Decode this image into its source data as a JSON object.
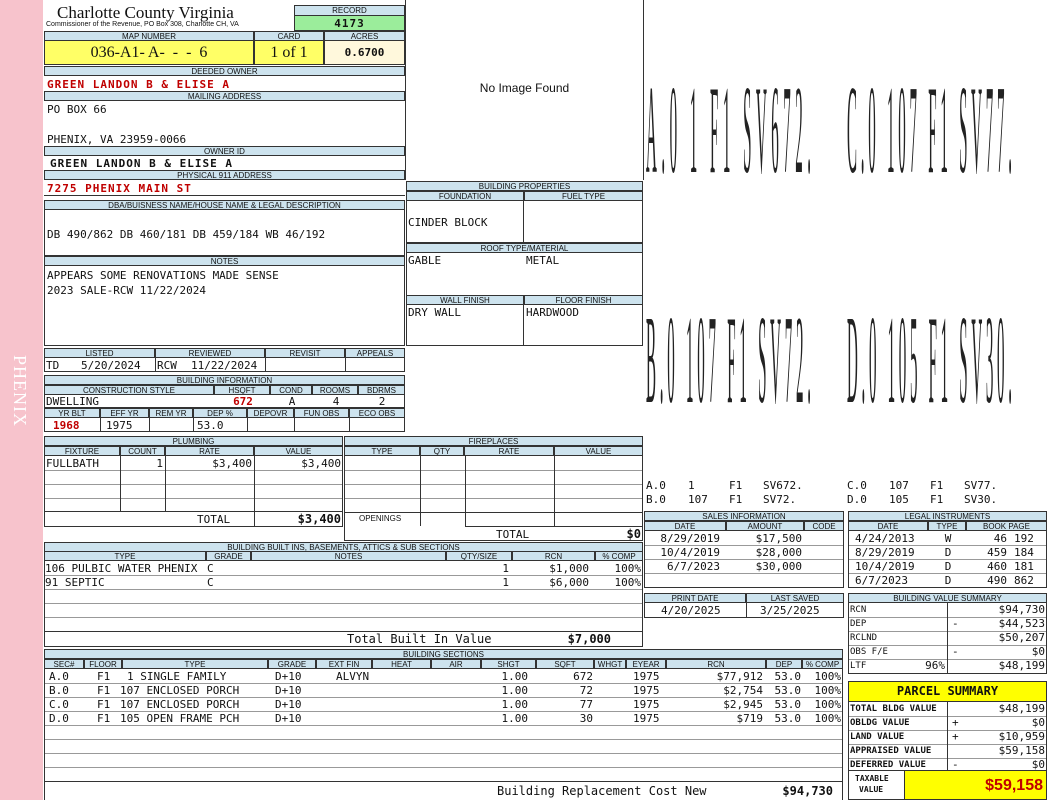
{
  "sidebar": {
    "district": "PHENIX"
  },
  "header": {
    "county": "Charlotte County Virginia",
    "commissioner": "Commissioner of the Revenue, PO Box 308, Charlotte CH, VA",
    "record_label": "RECORD",
    "record_value": "4173",
    "map_number_label": "MAP NUMBER",
    "map_number": "036-A1- A-  -  -  6",
    "card_label": "CARD",
    "card_value": "1 of 1",
    "acres_label": "ACRES",
    "acres_value": "0.6700"
  },
  "owner": {
    "deeded_owner_label": "DEEDED OWNER",
    "deeded_owner": "GREEN LANDON B & ELISE A",
    "mailing_label": "MAILING ADDRESS",
    "mailing_line1": "PO BOX 66",
    "mailing_line2": "PHENIX, VA 23959-0066",
    "owner_id_label": "OWNER ID",
    "owner_id": "GREEN LANDON B & ELISE A",
    "physical_label": "PHYSICAL 911 ADDRESS",
    "physical_address": "7275 PHENIX MAIN ST"
  },
  "legal": {
    "label": "DBA/BUISNESS NAME/HOUSE NAME & LEGAL DESCRIPTION",
    "text": "DB 490/862 DB 460/181 DB 459/184 WB 46/192"
  },
  "notes": {
    "label": "NOTES",
    "line1": "APPEARS SOME RENOVATIONS MADE SENSE",
    "line2": "2023 SALE-RCW 11/22/2024"
  },
  "image": {
    "placeholder": "No Image Found"
  },
  "building_properties": {
    "label": "BUILDING PROPERTIES",
    "foundation_label": "FOUNDATION",
    "fuel_type_label": "FUEL TYPE",
    "foundation": "CINDER BLOCK",
    "fuel_type": "",
    "roof_label": "ROOF TYPE/MATERIAL",
    "roof_type": "GABLE",
    "roof_material": "METAL",
    "wall_finish_label": "WALL FINISH",
    "floor_finish_label": "FLOOR FINISH",
    "wall_finish": "DRY WALL",
    "floor_finish": "HARDWOOD"
  },
  "review": {
    "listed_label": "LISTED",
    "reviewed_label": "REVIEWED",
    "revisit_label": "REVISIT",
    "appeals_label": "APPEALS",
    "listed_by": "TD",
    "listed_date": "5/20/2024",
    "reviewed_by": "RCW",
    "reviewed_date": "11/22/2024",
    "revisit": "",
    "appeals": ""
  },
  "building_info": {
    "label": "BUILDING INFORMATION",
    "construction_style_label": "CONSTRUCTION STYLE",
    "hsqft_label": "HSQFT",
    "cond_label": "COND",
    "rooms_label": "ROOMS",
    "bdrms_label": "BDRMS",
    "construction_style": "DWELLING",
    "hsqft": "672",
    "cond": "A",
    "rooms": "4",
    "bdrms": "2",
    "yr_blt_label": "YR BLT",
    "eff_yr_label": "EFF YR",
    "rem_yr_label": "REM YR",
    "dep_pct_label": "DEP %",
    "depovr_label": "DEPOVR",
    "fun_obs_label": "FUN OBS",
    "eco_obs_label": "ECO OBS",
    "yr_blt": "1968",
    "eff_yr": "1975",
    "rem_yr": "",
    "dep_pct": "53.0",
    "depovr": "",
    "fun_obs": "",
    "eco_obs": ""
  },
  "plumbing": {
    "label": "PLUMBING",
    "headers": [
      "FIXTURE",
      "COUNT",
      "RATE",
      "VALUE"
    ],
    "rows": [
      {
        "fixture": "FULLBATH",
        "count": "1",
        "rate": "$3,400",
        "value": "$3,400"
      }
    ],
    "total_label": "TOTAL",
    "total": "$3,400"
  },
  "fireplaces": {
    "label": "FIREPLACES",
    "headers": [
      "TYPE",
      "QTY",
      "RATE",
      "VALUE"
    ],
    "openings_label": "OPENINGS",
    "total_label": "TOTAL",
    "total": "$0"
  },
  "sketch": {
    "labels": [
      {
        "text": "A.0 1 F1 SV672."
      },
      {
        "text": "C.0 107 F1 SV77."
      },
      {
        "text": "B.0 107 F1 SV72."
      },
      {
        "text": "D.0 105 F1 SV30."
      }
    ],
    "legend": [
      [
        "A.0",
        "1",
        "F1",
        "SV672.",
        "C.0",
        "107",
        "F1",
        "SV77."
      ],
      [
        "B.0",
        "107",
        "F1",
        "SV72.",
        "D.0",
        "105",
        "F1",
        "SV30."
      ]
    ]
  },
  "sales": {
    "label": "SALES INFORMATION",
    "headers": [
      "DATE",
      "AMOUNT",
      "CODE"
    ],
    "rows": [
      {
        "date": "8/29/2019",
        "amount": "$17,500",
        "code": ""
      },
      {
        "date": "10/4/2019",
        "amount": "$28,000",
        "code": ""
      },
      {
        "date": "6/7/2023",
        "amount": "$30,000",
        "code": ""
      }
    ]
  },
  "legal_instruments": {
    "label": "LEGAL INSTRUMENTS",
    "headers": [
      "DATE",
      "TYPE",
      "BOOK PAGE"
    ],
    "rows": [
      {
        "date": "4/24/2013",
        "type": "W",
        "book": "46",
        "page": "192"
      },
      {
        "date": "8/29/2019",
        "type": "D",
        "book": "459",
        "page": "184"
      },
      {
        "date": "10/4/2019",
        "type": "D",
        "book": "460",
        "page": "181"
      },
      {
        "date": "6/7/2023",
        "type": "D",
        "book": "490",
        "page": "862"
      }
    ]
  },
  "print_info": {
    "print_date_label": "PRINT DATE",
    "last_saved_label": "LAST SAVED",
    "print_date": "4/20/2025",
    "last_saved": "3/25/2025"
  },
  "value_summary": {
    "label": "BUILDING VALUE SUMMARY",
    "rows": [
      {
        "label": "RCN",
        "sign": "",
        "pct": "",
        "value": "$94,730"
      },
      {
        "label": "DEP",
        "sign": "-",
        "pct": "",
        "value": "$44,523"
      },
      {
        "label": "RCLND",
        "sign": "",
        "pct": "",
        "value": "$50,207"
      },
      {
        "label": "OBS F/E",
        "sign": "-",
        "pct": "",
        "value": "$0"
      },
      {
        "label": "LTF",
        "sign": "",
        "pct": "96%",
        "value": "$48,199"
      }
    ]
  },
  "parcel_summary": {
    "label": "PARCEL SUMMARY",
    "rows": [
      {
        "label": "TOTAL BLDG VALUE",
        "sign": "",
        "value": "$48,199"
      },
      {
        "label": "OBLDG VALUE",
        "sign": "+",
        "value": "$0"
      },
      {
        "label": "LAND VALUE",
        "sign": "+",
        "value": "$10,959"
      },
      {
        "label": "APPRAISED VALUE",
        "sign": "",
        "value": "$59,158"
      },
      {
        "label": "DEFERRED VALUE",
        "sign": "-",
        "value": "$0"
      }
    ],
    "taxable_label_1": "TAXABLE",
    "taxable_label_2": "VALUE",
    "taxable_value": "$59,158"
  },
  "built_ins": {
    "label": "BUILDING BUILT INS, BASEMENTS, ATTICS & SUB SECTIONS",
    "headers": [
      "TYPE",
      "GRADE",
      "NOTES",
      "QTY/SIZE",
      "RCN",
      "% COMP"
    ],
    "rows": [
      {
        "type": "106 PULBIC WATER PHENIX",
        "grade": "C",
        "notes": "",
        "qty": "1",
        "rcn": "$1,000",
        "comp": "100%"
      },
      {
        "type": "91 SEPTIC",
        "grade": "C",
        "notes": "",
        "qty": "1",
        "rcn": "$6,000",
        "comp": "100%"
      }
    ],
    "total_label": "Total Built In Value",
    "total": "$7,000"
  },
  "sections": {
    "label": "BUILDING SECTIONS",
    "headers": [
      "SEC#",
      "FLOOR",
      "TYPE",
      "GRADE",
      "EXT FIN",
      "HEAT",
      "AIR",
      "SHGT",
      "SQFT",
      "WHGT",
      "EYEAR",
      "RCN",
      "DEP",
      "% COMP"
    ],
    "rows": [
      {
        "sec": "A.0",
        "floor": "F1",
        "type": "1 SINGLE FAMILY",
        "grade": "D+10",
        "ext": "ALVYN",
        "heat": "",
        "air": "",
        "shgt": "1.00",
        "sqft": "672",
        "whgt": "",
        "eyear": "1975",
        "rcn": "$77,912",
        "dep": "53.0",
        "comp": "100%"
      },
      {
        "sec": "B.0",
        "floor": "F1",
        "type": "107 ENCLOSED PORCH",
        "grade": "D+10",
        "ext": "",
        "heat": "",
        "air": "",
        "shgt": "1.00",
        "sqft": "72",
        "whgt": "",
        "eyear": "1975",
        "rcn": "$2,754",
        "dep": "53.0",
        "comp": "100%"
      },
      {
        "sec": "C.0",
        "floor": "F1",
        "type": "107 ENCLOSED PORCH",
        "grade": "D+10",
        "ext": "",
        "heat": "",
        "air": "",
        "shgt": "1.00",
        "sqft": "77",
        "whgt": "",
        "eyear": "1975",
        "rcn": "$2,945",
        "dep": "53.0",
        "comp": "100%"
      },
      {
        "sec": "D.0",
        "floor": "F1",
        "type": "105 OPEN FRAME PCH",
        "grade": "D+10",
        "ext": "",
        "heat": "",
        "air": "",
        "shgt": "1.00",
        "sqft": "30",
        "whgt": "",
        "eyear": "1975",
        "rcn": "$719",
        "dep": "53.0",
        "comp": "100%"
      }
    ],
    "total_label": "Building Replacement Cost New",
    "total": "$94,730"
  }
}
